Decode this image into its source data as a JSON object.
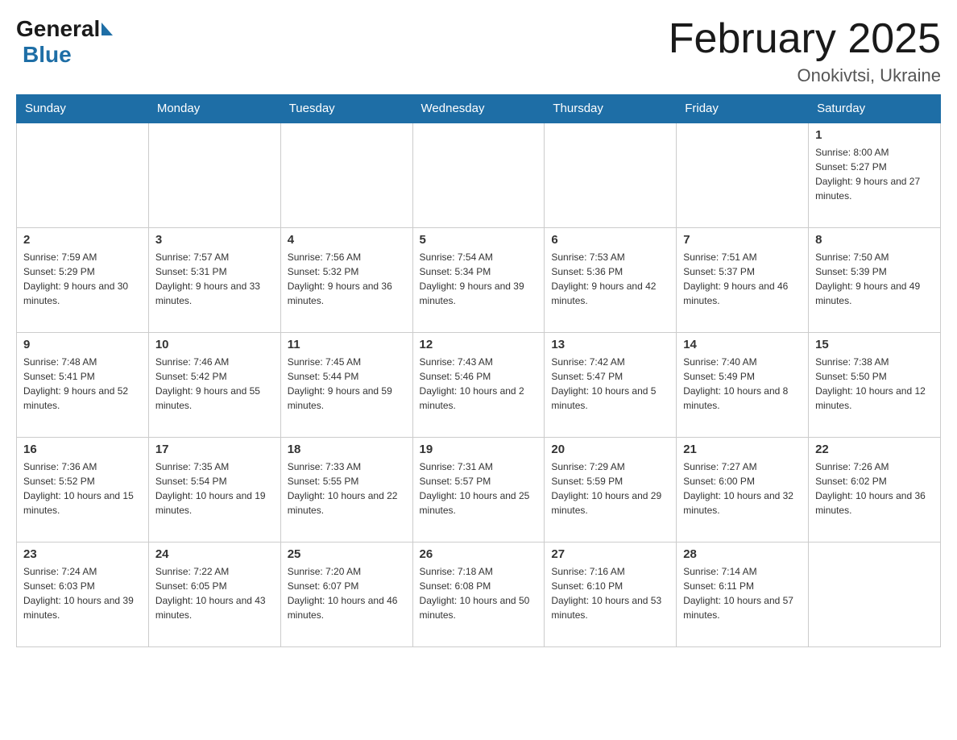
{
  "logo": {
    "general": "General",
    "blue": "Blue"
  },
  "title": {
    "month_year": "February 2025",
    "location": "Onokivtsi, Ukraine"
  },
  "weekdays": [
    "Sunday",
    "Monday",
    "Tuesday",
    "Wednesday",
    "Thursday",
    "Friday",
    "Saturday"
  ],
  "weeks": [
    {
      "days": [
        {
          "number": "",
          "info": "",
          "empty": true
        },
        {
          "number": "",
          "info": "",
          "empty": true
        },
        {
          "number": "",
          "info": "",
          "empty": true
        },
        {
          "number": "",
          "info": "",
          "empty": true
        },
        {
          "number": "",
          "info": "",
          "empty": true
        },
        {
          "number": "",
          "info": "",
          "empty": true
        },
        {
          "number": "1",
          "info": "Sunrise: 8:00 AM\nSunset: 5:27 PM\nDaylight: 9 hours and 27 minutes.",
          "empty": false
        }
      ]
    },
    {
      "days": [
        {
          "number": "2",
          "info": "Sunrise: 7:59 AM\nSunset: 5:29 PM\nDaylight: 9 hours and 30 minutes.",
          "empty": false
        },
        {
          "number": "3",
          "info": "Sunrise: 7:57 AM\nSunset: 5:31 PM\nDaylight: 9 hours and 33 minutes.",
          "empty": false
        },
        {
          "number": "4",
          "info": "Sunrise: 7:56 AM\nSunset: 5:32 PM\nDaylight: 9 hours and 36 minutes.",
          "empty": false
        },
        {
          "number": "5",
          "info": "Sunrise: 7:54 AM\nSunset: 5:34 PM\nDaylight: 9 hours and 39 minutes.",
          "empty": false
        },
        {
          "number": "6",
          "info": "Sunrise: 7:53 AM\nSunset: 5:36 PM\nDaylight: 9 hours and 42 minutes.",
          "empty": false
        },
        {
          "number": "7",
          "info": "Sunrise: 7:51 AM\nSunset: 5:37 PM\nDaylight: 9 hours and 46 minutes.",
          "empty": false
        },
        {
          "number": "8",
          "info": "Sunrise: 7:50 AM\nSunset: 5:39 PM\nDaylight: 9 hours and 49 minutes.",
          "empty": false
        }
      ]
    },
    {
      "days": [
        {
          "number": "9",
          "info": "Sunrise: 7:48 AM\nSunset: 5:41 PM\nDaylight: 9 hours and 52 minutes.",
          "empty": false
        },
        {
          "number": "10",
          "info": "Sunrise: 7:46 AM\nSunset: 5:42 PM\nDaylight: 9 hours and 55 minutes.",
          "empty": false
        },
        {
          "number": "11",
          "info": "Sunrise: 7:45 AM\nSunset: 5:44 PM\nDaylight: 9 hours and 59 minutes.",
          "empty": false
        },
        {
          "number": "12",
          "info": "Sunrise: 7:43 AM\nSunset: 5:46 PM\nDaylight: 10 hours and 2 minutes.",
          "empty": false
        },
        {
          "number": "13",
          "info": "Sunrise: 7:42 AM\nSunset: 5:47 PM\nDaylight: 10 hours and 5 minutes.",
          "empty": false
        },
        {
          "number": "14",
          "info": "Sunrise: 7:40 AM\nSunset: 5:49 PM\nDaylight: 10 hours and 8 minutes.",
          "empty": false
        },
        {
          "number": "15",
          "info": "Sunrise: 7:38 AM\nSunset: 5:50 PM\nDaylight: 10 hours and 12 minutes.",
          "empty": false
        }
      ]
    },
    {
      "days": [
        {
          "number": "16",
          "info": "Sunrise: 7:36 AM\nSunset: 5:52 PM\nDaylight: 10 hours and 15 minutes.",
          "empty": false
        },
        {
          "number": "17",
          "info": "Sunrise: 7:35 AM\nSunset: 5:54 PM\nDaylight: 10 hours and 19 minutes.",
          "empty": false
        },
        {
          "number": "18",
          "info": "Sunrise: 7:33 AM\nSunset: 5:55 PM\nDaylight: 10 hours and 22 minutes.",
          "empty": false
        },
        {
          "number": "19",
          "info": "Sunrise: 7:31 AM\nSunset: 5:57 PM\nDaylight: 10 hours and 25 minutes.",
          "empty": false
        },
        {
          "number": "20",
          "info": "Sunrise: 7:29 AM\nSunset: 5:59 PM\nDaylight: 10 hours and 29 minutes.",
          "empty": false
        },
        {
          "number": "21",
          "info": "Sunrise: 7:27 AM\nSunset: 6:00 PM\nDaylight: 10 hours and 32 minutes.",
          "empty": false
        },
        {
          "number": "22",
          "info": "Sunrise: 7:26 AM\nSunset: 6:02 PM\nDaylight: 10 hours and 36 minutes.",
          "empty": false
        }
      ]
    },
    {
      "days": [
        {
          "number": "23",
          "info": "Sunrise: 7:24 AM\nSunset: 6:03 PM\nDaylight: 10 hours and 39 minutes.",
          "empty": false
        },
        {
          "number": "24",
          "info": "Sunrise: 7:22 AM\nSunset: 6:05 PM\nDaylight: 10 hours and 43 minutes.",
          "empty": false
        },
        {
          "number": "25",
          "info": "Sunrise: 7:20 AM\nSunset: 6:07 PM\nDaylight: 10 hours and 46 minutes.",
          "empty": false
        },
        {
          "number": "26",
          "info": "Sunrise: 7:18 AM\nSunset: 6:08 PM\nDaylight: 10 hours and 50 minutes.",
          "empty": false
        },
        {
          "number": "27",
          "info": "Sunrise: 7:16 AM\nSunset: 6:10 PM\nDaylight: 10 hours and 53 minutes.",
          "empty": false
        },
        {
          "number": "28",
          "info": "Sunrise: 7:14 AM\nSunset: 6:11 PM\nDaylight: 10 hours and 57 minutes.",
          "empty": false
        },
        {
          "number": "",
          "info": "",
          "empty": true
        }
      ]
    }
  ]
}
